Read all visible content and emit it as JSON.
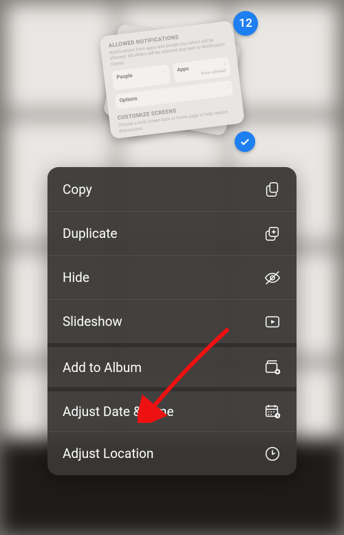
{
  "selection_count": "12",
  "stacked_screenshot": {
    "section1": {
      "title": "ALLOWED NOTIFICATIONS",
      "subtitle": "Notifications from apps and people you select will be allowed. All others will be silenced and sent to Notification Center.",
      "tile_people": "People",
      "tile_apps": "Apps",
      "tile_none": "None allowed",
      "tile_options": "Options"
    },
    "section2": {
      "title": "CUSTOMIZE SCREENS",
      "subtitle": "Choose a lock screen face or home page to help reduce distractions."
    }
  },
  "menu": {
    "copy": "Copy",
    "duplicate": "Duplicate",
    "hide": "Hide",
    "slideshow": "Slideshow",
    "add_to_album": "Add to Album",
    "adjust_date_time": "Adjust Date & Time",
    "adjust_location": "Adjust Location"
  },
  "annotation_target": "adjust_date_time"
}
